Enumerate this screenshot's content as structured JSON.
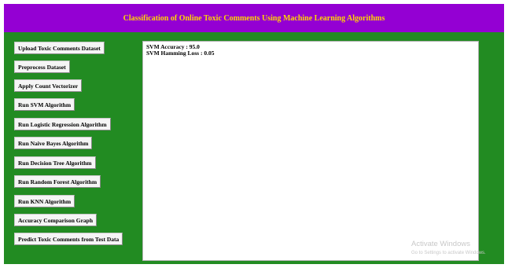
{
  "window": {
    "title": "Classification of Online Toxic Comments Using Machine Learning Algorithms",
    "colors": {
      "background": "#228b22",
      "title_bar": "#9400d3",
      "title_text": "#ffd700"
    }
  },
  "buttons": [
    {
      "label": "Upload Toxic Comments Dataset"
    },
    {
      "label": "Preprocess Dataset"
    },
    {
      "label": "Apply Count Vectorizer"
    },
    {
      "label": "Run SVM Algorithm"
    },
    {
      "label": "Run Logistic Regression Algorithm"
    },
    {
      "label": "Run Naive Bayes Algorithm"
    },
    {
      "label": "Run Decision Tree Algorithm"
    },
    {
      "label": "Run Random Forest Algorithm"
    },
    {
      "label": "Run KNN Algorithm"
    },
    {
      "label": "Accuracy Comparison Graph"
    },
    {
      "label": "Predict Toxic Comments from Test Data"
    }
  ],
  "output": {
    "lines": [
      "SVM Accuracy : 95.0",
      "SVM Hamming Loss : 0.05"
    ]
  },
  "watermark": {
    "title": "Activate Windows",
    "subtitle": "Go to Settings to activate Windows."
  }
}
